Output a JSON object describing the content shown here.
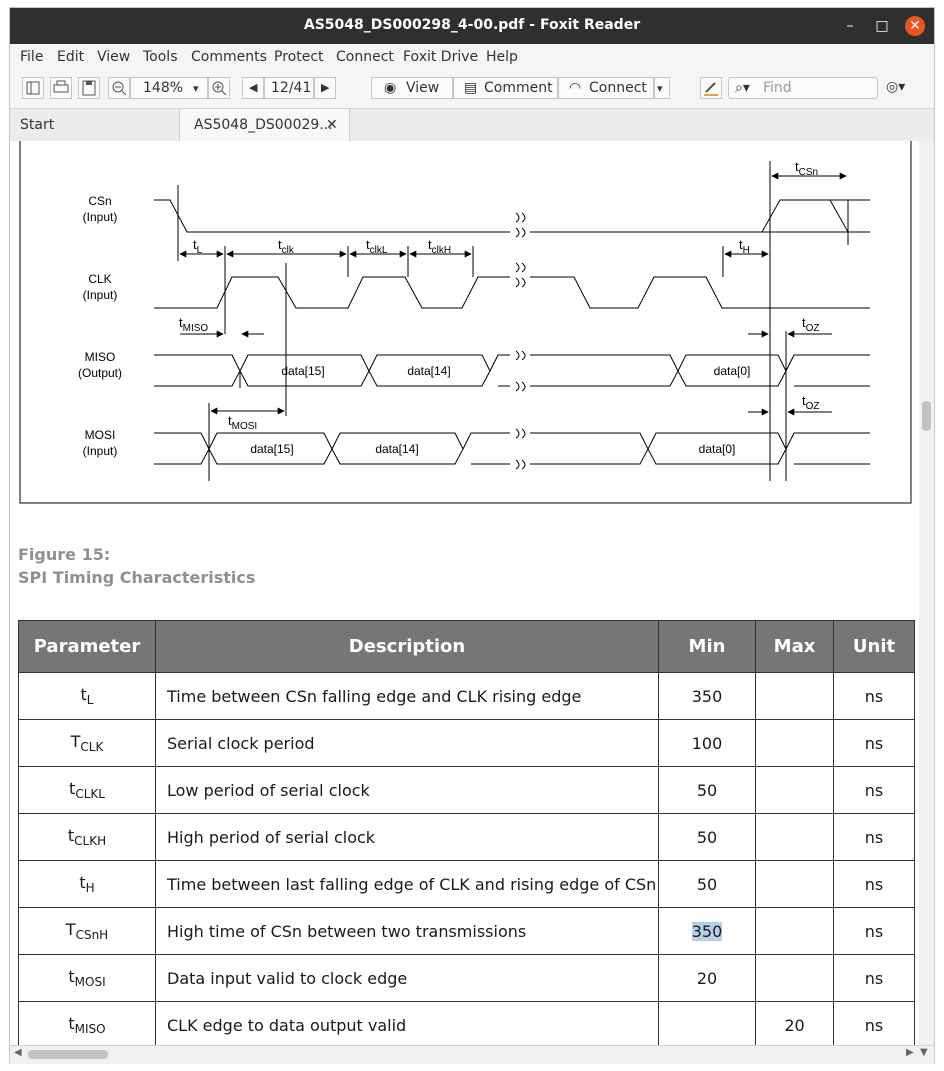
{
  "window": {
    "title": "AS5048_DS000298_4-00.pdf - Foxit Reader"
  },
  "menu": [
    "File",
    "Edit",
    "View",
    "Tools",
    "Comments",
    "Protect",
    "Connect",
    "Foxit Drive",
    "Help"
  ],
  "toolbar": {
    "zoom": "148%",
    "page": "12/41",
    "view_label": "View",
    "comment_label": "Comment",
    "connect_label": "Connect",
    "find_placeholder": "Find"
  },
  "tabs": {
    "start": "Start",
    "doc": "AS5048_DS00029..."
  },
  "diagram": {
    "signals": [
      {
        "name": "CSn",
        "dir": "(Input)"
      },
      {
        "name": "CLK",
        "dir": "(Input)"
      },
      {
        "name": "MISO",
        "dir": "(Output)"
      },
      {
        "name": "MOSI",
        "dir": "(Input)"
      }
    ],
    "labels": {
      "tCSn": {
        "base": "t",
        "sub": "CSn"
      },
      "tL": {
        "base": "t",
        "sub": "L"
      },
      "tclk": {
        "base": "t",
        "sub": "clk"
      },
      "tclkL": {
        "base": "t",
        "sub": "clkL"
      },
      "tclkH": {
        "base": "t",
        "sub": "clkH"
      },
      "tH": {
        "base": "t",
        "sub": "H"
      },
      "tMISO": {
        "base": "t",
        "sub": "MISO"
      },
      "tOZ": {
        "base": "t",
        "sub": "OZ"
      },
      "tMOSI": {
        "base": "t",
        "sub": "MOSI"
      }
    },
    "miso_data": [
      "data[15]",
      "data[14]",
      "data[0]"
    ],
    "mosi_data": [
      "data[15]",
      "data[14]",
      "data[0]"
    ]
  },
  "figure": {
    "number": "Figure 15:",
    "title": "SPI Timing Characteristics"
  },
  "table": {
    "headers": [
      "Parameter",
      "Description",
      "Min",
      "Max",
      "Unit"
    ],
    "rows": [
      {
        "p": "t",
        "ps": "L",
        "desc": "Time between CSn falling edge and CLK rising edge",
        "min": "350",
        "max": "",
        "unit": "ns"
      },
      {
        "p": "T",
        "ps": "CLK",
        "desc": "Serial clock period",
        "min": "100",
        "max": "",
        "unit": "ns"
      },
      {
        "p": "t",
        "ps": "CLKL",
        "desc": "Low period of serial clock",
        "min": "50",
        "max": "",
        "unit": "ns"
      },
      {
        "p": "t",
        "ps": "CLKH",
        "desc": "High period of serial clock",
        "min": "50",
        "max": "",
        "unit": "ns"
      },
      {
        "p": "t",
        "ps": "H",
        "desc": "Time between last falling edge of CLK and rising edge of CSn",
        "min": "50",
        "max": "",
        "unit": "ns"
      },
      {
        "p": "T",
        "ps": "CSnH",
        "desc": "High time of CSn between two transmissions",
        "min": "350",
        "max": "",
        "unit": "ns"
      },
      {
        "p": "t",
        "ps": "MOSI",
        "desc": "Data input valid to clock edge",
        "min": "20",
        "max": "",
        "unit": "ns"
      },
      {
        "p": "t",
        "ps": "MISO",
        "desc": "CLK edge to data output valid",
        "min": "",
        "max": "20",
        "unit": "ns"
      }
    ]
  }
}
